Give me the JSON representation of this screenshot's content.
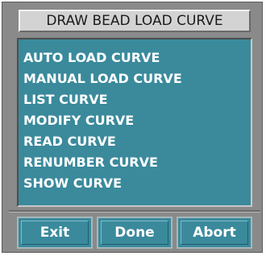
{
  "dialog": {
    "title": "DRAW BEAD LOAD CURVE"
  },
  "menu": {
    "items": [
      {
        "label": "AUTO LOAD CURVE"
      },
      {
        "label": "MANUAL LOAD CURVE"
      },
      {
        "label": "LIST CURVE"
      },
      {
        "label": "MODIFY CURVE"
      },
      {
        "label": "READ CURVE"
      },
      {
        "label": "RENUMBER CURVE"
      },
      {
        "label": "SHOW CURVE"
      }
    ]
  },
  "buttons": {
    "exit": "Exit",
    "done": "Done",
    "abort": "Abort"
  },
  "colors": {
    "panel": "#3a8a9c",
    "window": "#8a8a8a",
    "title_bar": "#d3d3d3"
  }
}
